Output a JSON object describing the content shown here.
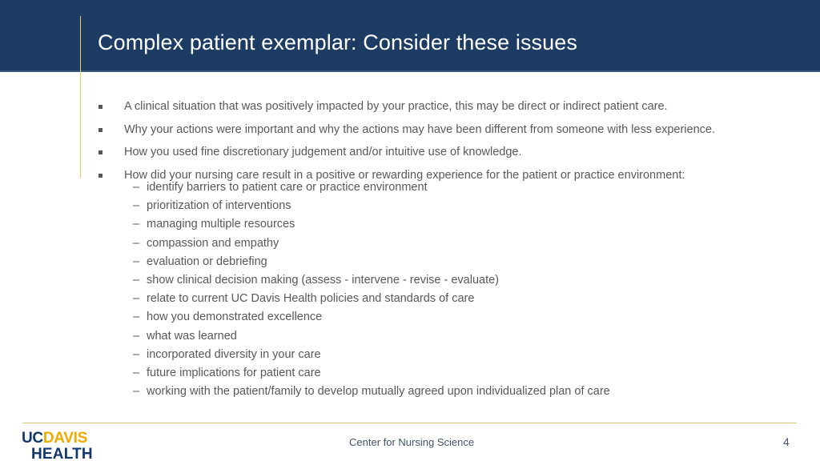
{
  "slide": {
    "title": "Complex patient exemplar: Consider these issues",
    "colors": {
      "header_navy": "#1d3c63",
      "accent_gold": "#e8c969",
      "body_text": "#585858",
      "logo_navy": "#12386b",
      "logo_gold": "#f2a900",
      "footer_text": "#44536b"
    }
  },
  "bullets": [
    {
      "text": "A clinical situation that was positively impacted by your practice, this may be direct or indirect patient care."
    },
    {
      "text": "Why your actions were important and why the actions may have been different from someone with less experience."
    },
    {
      "text": "How you used fine discretionary judgement and/or intuitive use of knowledge."
    },
    {
      "text": "How did your nursing care result in a positive or rewarding experience for the patient or practice environment:"
    }
  ],
  "sub_bullets": [
    {
      "marker": "–",
      "text": "identify barriers to patient care or practice environment"
    },
    {
      "marker": "–",
      "text": "prioritization of interventions"
    },
    {
      "marker": "–",
      "text": "managing multiple resources"
    },
    {
      "marker": "–",
      "text": "compassion and empathy"
    },
    {
      "marker": "–",
      "text": "evaluation or debriefing"
    },
    {
      "marker": "–",
      "text": "show clinical decision making (assess - intervene - revise - evaluate)"
    },
    {
      "marker": "–",
      "text": "relate to current UC Davis Health policies and standards of care"
    },
    {
      "marker": "–",
      "text": "how you demonstrated excellence"
    },
    {
      "marker": "–",
      "text": "what was learned"
    },
    {
      "marker": "–",
      "text": "incorporated diversity in your care"
    },
    {
      "marker": "–",
      "text": "future implications for patient care"
    },
    {
      "marker": "–",
      "text": "working with the patient/family to develop mutually agreed upon individualized plan of care"
    }
  ],
  "footer": {
    "logo_uc": "UC",
    "logo_davis": "DAVIS",
    "logo_health": "HEALTH",
    "title": "Center for Nursing Science",
    "page_number": "4"
  }
}
